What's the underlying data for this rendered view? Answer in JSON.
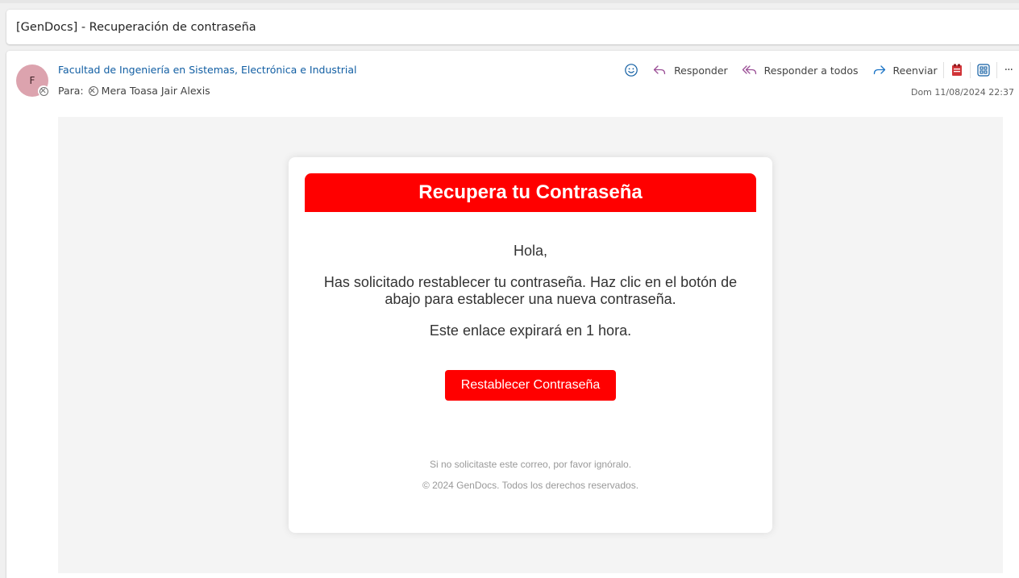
{
  "subject": "[GenDocs] - Recuperación de contraseña",
  "message": {
    "avatar_initial": "F",
    "avatar_color": "#dca3ae",
    "sender": "Facultad de Ingeniería en Sistemas, Electrónica e Industrial",
    "to_label": "Para:",
    "recipient": "Mera Toasa Jair Alexis",
    "date": "Dom 11/08/2024 22:37"
  },
  "toolbar": {
    "react_icon": "smiley-icon",
    "reply_label": "Responder",
    "reply_all_label": "Responder a todos",
    "forward_label": "Reenviar",
    "more_label": "···"
  },
  "email": {
    "header_title": "Recupera tu Contraseña",
    "greeting": "Hola,",
    "message": "Has solicitado restablecer tu contraseña. Haz clic en el botón de abajo para establecer una nueva contraseña.",
    "expiry": "Este enlace expirará en 1 hora.",
    "button_label": "Restablecer Contraseña",
    "footer_note": "Si no solicitaste este correo, por favor ignóralo.",
    "footer_copyright": "© 2024 GenDocs. Todos los derechos reservados.",
    "accent_color": "#ff0000"
  }
}
